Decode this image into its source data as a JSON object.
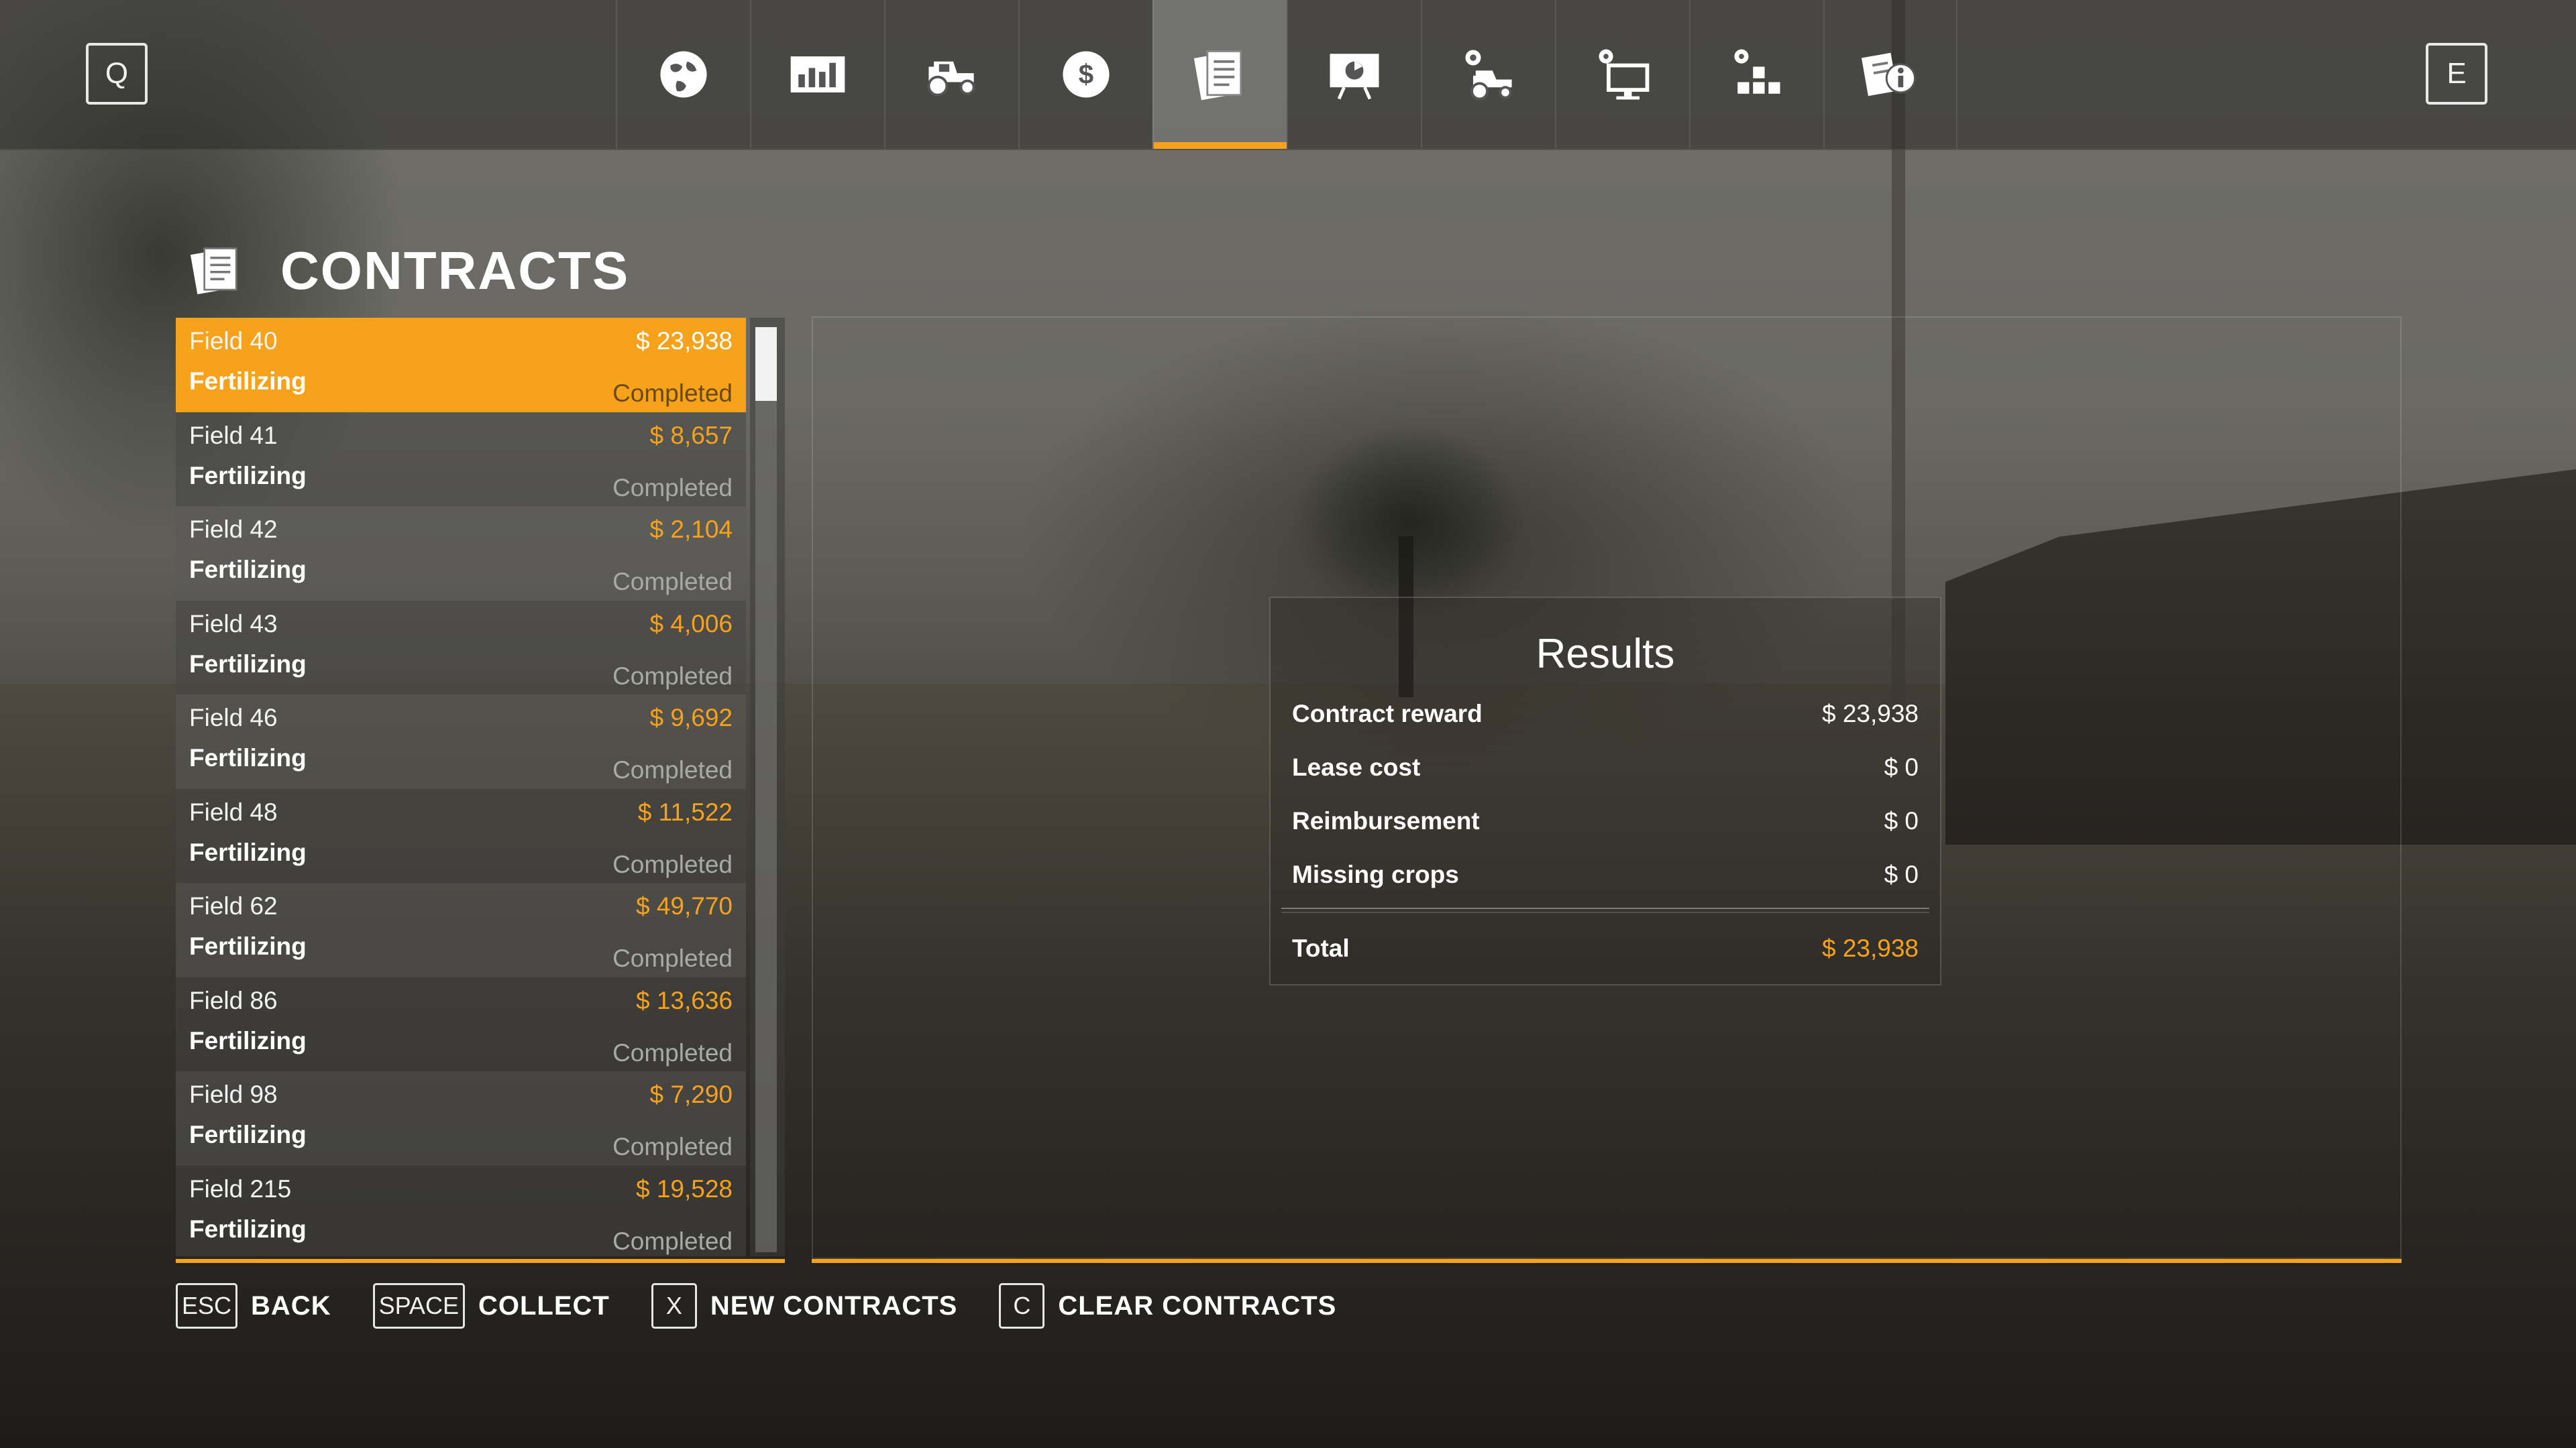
{
  "topbar": {
    "left_key": "Q",
    "right_key": "E",
    "tabs": [
      {
        "icon": "globe-icon",
        "active": false
      },
      {
        "icon": "prices-chart-icon",
        "active": false
      },
      {
        "icon": "tractor-icon",
        "active": false
      },
      {
        "icon": "finances-dollar-icon",
        "active": false
      },
      {
        "icon": "contracts-icon",
        "active": true
      },
      {
        "icon": "statistics-presentation-icon",
        "active": false
      },
      {
        "icon": "vehicle-settings-icon",
        "active": false
      },
      {
        "icon": "general-settings-icon",
        "active": false
      },
      {
        "icon": "controls-settings-icon",
        "active": false
      },
      {
        "icon": "help-info-icon",
        "active": false
      }
    ]
  },
  "page": {
    "title": "CONTRACTS"
  },
  "contracts": [
    {
      "field": "Field 40",
      "reward": "$ 23,938",
      "type": "Fertilizing",
      "status": "Completed",
      "selected": true
    },
    {
      "field": "Field 41",
      "reward": "$ 8,657",
      "type": "Fertilizing",
      "status": "Completed"
    },
    {
      "field": "Field 42",
      "reward": "$ 2,104",
      "type": "Fertilizing",
      "status": "Completed"
    },
    {
      "field": "Field 43",
      "reward": "$ 4,006",
      "type": "Fertilizing",
      "status": "Completed"
    },
    {
      "field": "Field 46",
      "reward": "$ 9,692",
      "type": "Fertilizing",
      "status": "Completed"
    },
    {
      "field": "Field 48",
      "reward": "$ 11,522",
      "type": "Fertilizing",
      "status": "Completed"
    },
    {
      "field": "Field 62",
      "reward": "$ 49,770",
      "type": "Fertilizing",
      "status": "Completed"
    },
    {
      "field": "Field 86",
      "reward": "$ 13,636",
      "type": "Fertilizing",
      "status": "Completed"
    },
    {
      "field": "Field 98",
      "reward": "$ 7,290",
      "type": "Fertilizing",
      "status": "Completed"
    },
    {
      "field": "Field 215",
      "reward": "$ 19,528",
      "type": "Fertilizing",
      "status": "Completed"
    }
  ],
  "results": {
    "title": "Results",
    "lines": [
      {
        "label": "Contract reward",
        "value": "$ 23,938"
      },
      {
        "label": "Lease cost",
        "value": "$ 0"
      },
      {
        "label": "Reimbursement",
        "value": "$ 0"
      },
      {
        "label": "Missing crops",
        "value": "$ 0"
      }
    ],
    "total_label": "Total",
    "total_value": "$ 23,938"
  },
  "footer": [
    {
      "key": "ESC",
      "label": "BACK"
    },
    {
      "key": "SPACE",
      "label": "COLLECT"
    },
    {
      "key": "X",
      "label": "NEW CONTRACTS"
    },
    {
      "key": "C",
      "label": "CLEAR CONTRACTS"
    }
  ],
  "colors": {
    "accent": "#f7a21b",
    "text": "#ffffff",
    "muted": "#a9a9a6"
  }
}
